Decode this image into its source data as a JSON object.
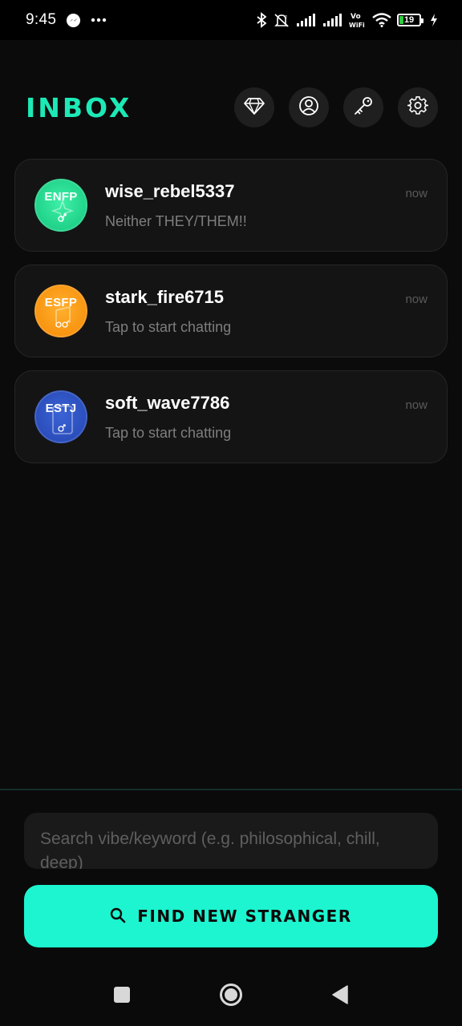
{
  "status_bar": {
    "time": "9:45",
    "battery_level": "19",
    "icons": [
      "messenger-icon",
      "more-dots-icon",
      "bluetooth-icon",
      "alarm-off-icon",
      "signal-icon",
      "signal-icon",
      "vowifi-icon",
      "wifi-icon",
      "battery-icon",
      "charging-icon"
    ],
    "vowifi_label": "Vo WiFi"
  },
  "header": {
    "title": "INBOX",
    "actions": [
      "diamond-icon",
      "profile-icon",
      "key-icon",
      "settings-icon"
    ]
  },
  "chats": [
    {
      "name": "wise_rebel5337",
      "preview": "Neither THEY/THEM!!",
      "time": "now",
      "mbti": "ENFP",
      "avatar_color": "#1ed98f",
      "gender_icon": "male-icon"
    },
    {
      "name": "stark_fire6715",
      "preview": "Tap to start chatting",
      "time": "now",
      "mbti": "ESFP",
      "avatar_color": "#ff9a1a",
      "gender_icon": "female-male-icon"
    },
    {
      "name": "soft_wave7786",
      "preview": "Tap to start chatting",
      "time": "now",
      "mbti": "ESTJ",
      "avatar_color": "#2f56c9",
      "gender_icon": "male-icon"
    }
  ],
  "search": {
    "placeholder": "Search vibe/keyword (e.g. philosophical, chill, deep)",
    "value": ""
  },
  "find_button": {
    "label": "FIND NEW STRANGER",
    "icon": "search-icon"
  },
  "colors": {
    "accent": "#1de9b6",
    "button": "#1cf5cf",
    "background": "#0b0b0b",
    "card": "#141414"
  },
  "nav": [
    "recents-button",
    "home-button",
    "back-button"
  ]
}
